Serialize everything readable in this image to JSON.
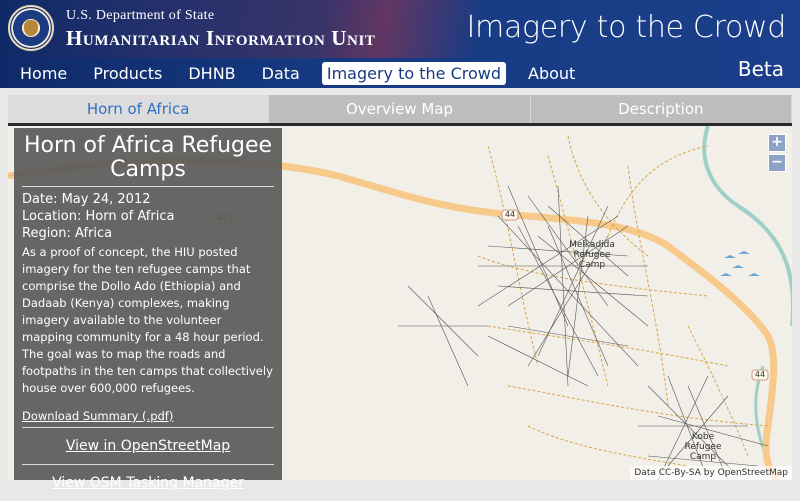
{
  "header": {
    "dept": "U.S. Department of State",
    "unit": "Humanitarian Information Unit",
    "title": "Imagery to the Crowd",
    "beta": "Beta"
  },
  "nav": [
    "Home",
    "Products",
    "DHNB",
    "Data",
    "Imagery to the Crowd",
    "About"
  ],
  "nav_active": "Imagery to the Crowd",
  "tabs": [
    "Horn of Africa",
    "Overview Map",
    "Description"
  ],
  "panel": {
    "title": "Horn of Africa Refugee Camps",
    "date": "Date: May 24, 2012",
    "location": "Location: Horn of Africa",
    "region": "Region: Africa",
    "description": "As a proof of concept, the HIU posted imagery for the ten refugee camps that comprise the Dollo Ado (Ethiopia) and Dadaab (Kenya) complexes, making imagery available to the volunteer mapping community for a 48 hour period. The goal was to map the roads and footpaths in the ten camps that collectively house over 600,000 refugees.",
    "download": "Download Summary (.pdf)",
    "osm_link": "View in OpenStreetMap",
    "tasking_link": "View OSM Tasking Manager"
  },
  "map": {
    "road_label": "44",
    "camp1": "Melkadida Refugee Camp",
    "camp2": "Kobe Refugee Camp",
    "zoom_in": "+",
    "zoom_out": "−",
    "attribution": "Data CC-By-SA by OpenStreetMap"
  },
  "colors": {
    "header": "#163a82",
    "tab_active_text": "#2f72c2",
    "road": "#f7c98a",
    "river": "#9fd0c8"
  }
}
